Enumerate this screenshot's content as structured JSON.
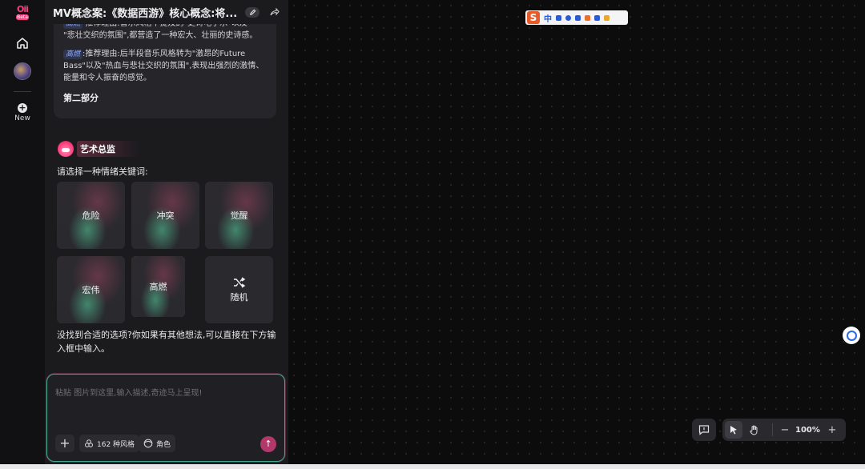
{
  "rail": {
    "logo_text": "Oii",
    "logo_sub": "Beta",
    "new_label": "New"
  },
  "header": {
    "title": "MV概念案:《数据西游》核心概念:将..."
  },
  "card": {
    "line_cut_tag": "高燃",
    "line_cut": "推荐理由:音乐风格中提及的\"史诗电子乐\"以及",
    "line_cut2": "\"悲壮交织的氛围\",都营造了一种宏大、壮丽的史诗感。",
    "tag": "高燃",
    "reason": ":推荐理由:后半段音乐风格转为\"激昂的Future Bass\"以及\"热血与悲壮交织的氛围\",表现出强烈的激情、能量和令人振奋的感觉。",
    "section": "第二部分"
  },
  "agent": {
    "name": "艺术总监",
    "prompt": "请选择一种情绪关键词:"
  },
  "options": [
    "危险",
    "冲突",
    "觉醒",
    "宏伟",
    "高燃",
    "随机"
  ],
  "selected": "高燃",
  "hint": "没找到合适的选项?你如果有其他想法,可以直接在下方输入框中输入。",
  "composer": {
    "placeholder": "粘贴 图片到这里,输入描述,奇迹马上呈现!",
    "styles_label": "162 种风格",
    "role_label": "角色"
  },
  "ime": {
    "mode": "中"
  },
  "zoom": {
    "value": "100%"
  }
}
